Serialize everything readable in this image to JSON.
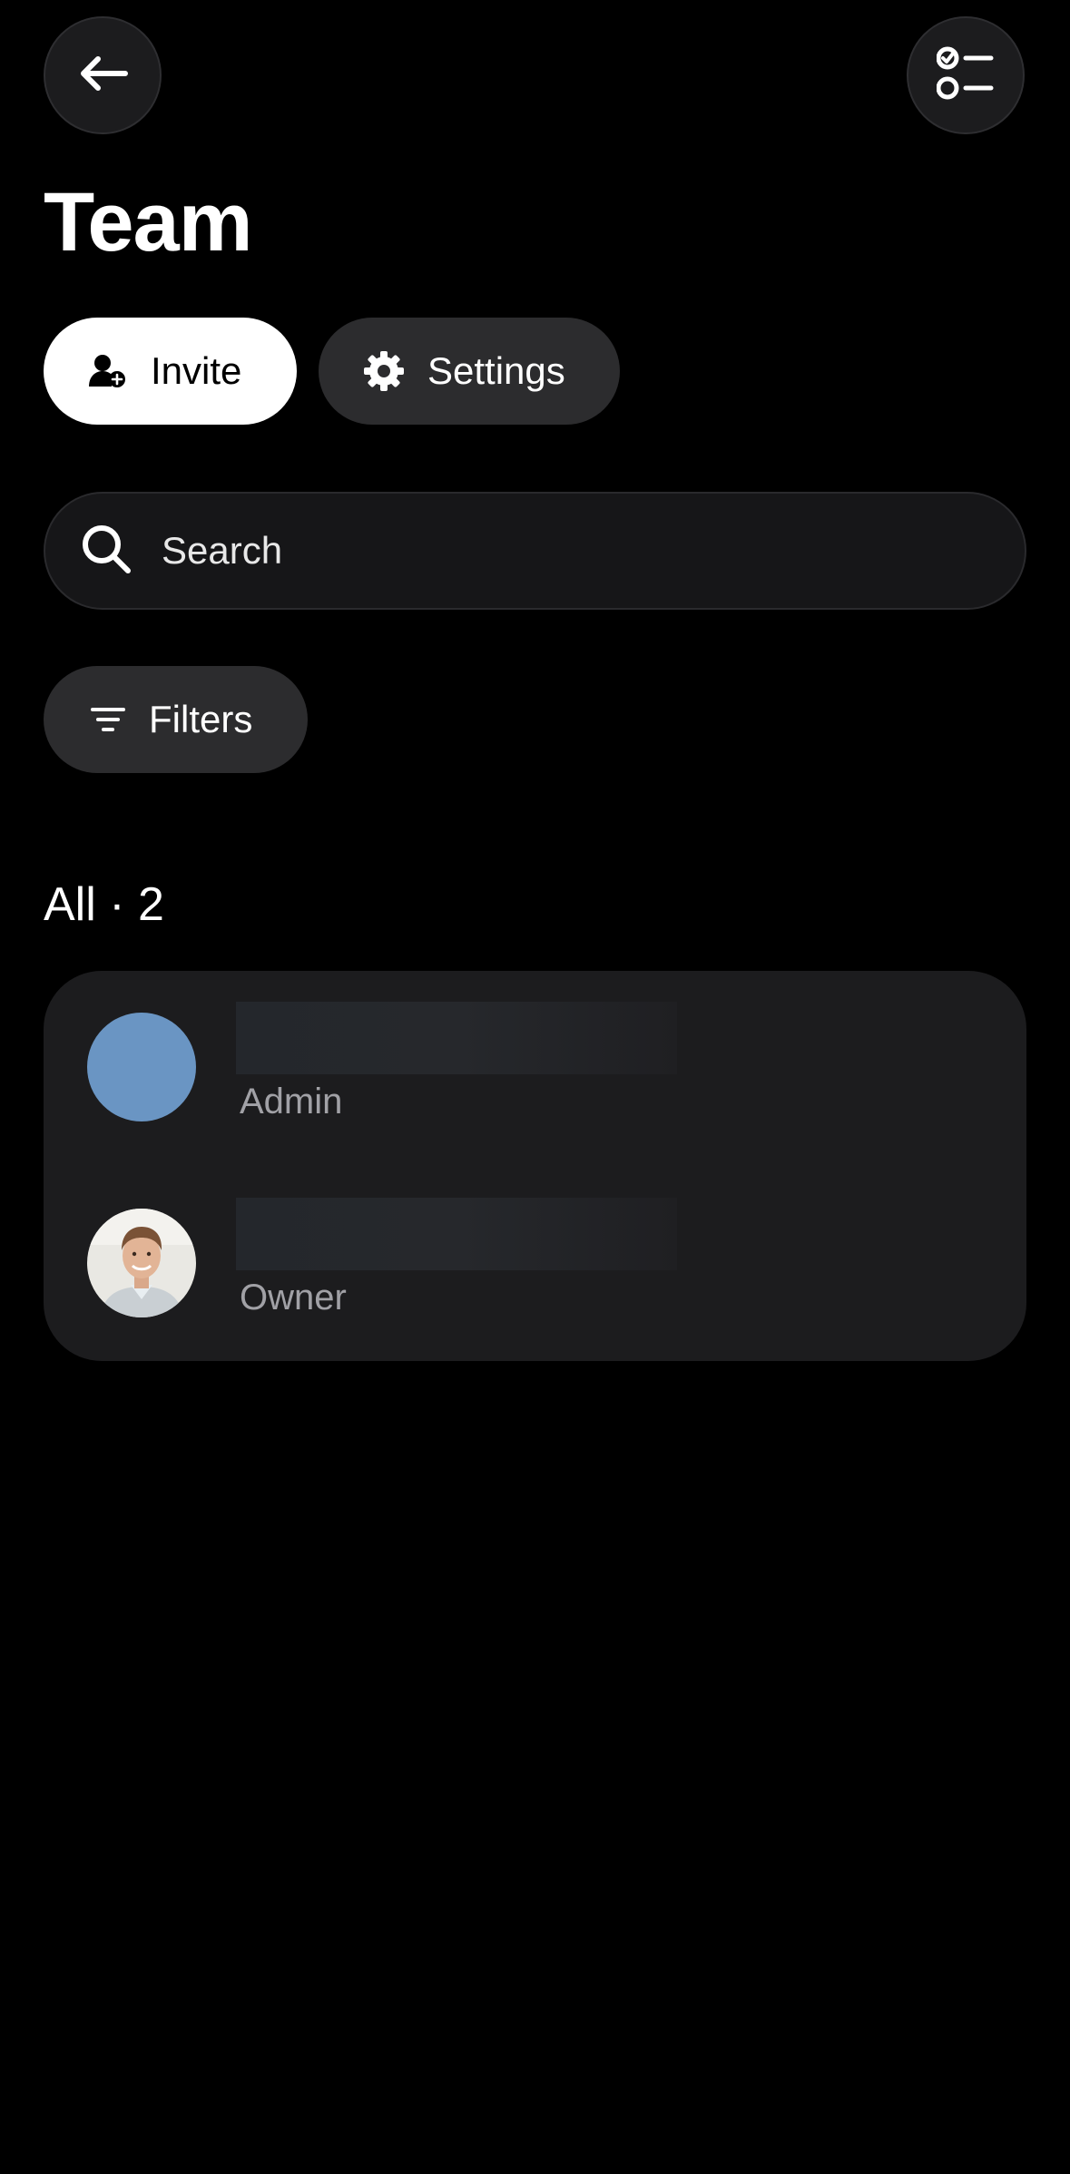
{
  "header": {
    "title": "Team",
    "back_icon": "arrow-left-icon",
    "tasks_icon": "checklist-icon"
  },
  "actions": {
    "invite_label": "Invite",
    "invite_icon": "user-plus-icon",
    "settings_label": "Settings",
    "settings_icon": "gear-icon"
  },
  "search": {
    "placeholder": "Search",
    "value": "",
    "icon": "search-icon"
  },
  "filters": {
    "label": "Filters",
    "icon": "filter-icon"
  },
  "members_section": {
    "heading": "All · 2",
    "members": [
      {
        "role": "Admin",
        "avatar_type": "color",
        "avatar_color": "#6a95c3"
      },
      {
        "role": "Owner",
        "avatar_type": "photo"
      }
    ]
  },
  "colors": {
    "background": "#000000",
    "card": "#1c1c1e",
    "pill_dark": "#2c2c2e",
    "pill_light": "#ffffff",
    "secondary_text": "#a1a1a6"
  }
}
